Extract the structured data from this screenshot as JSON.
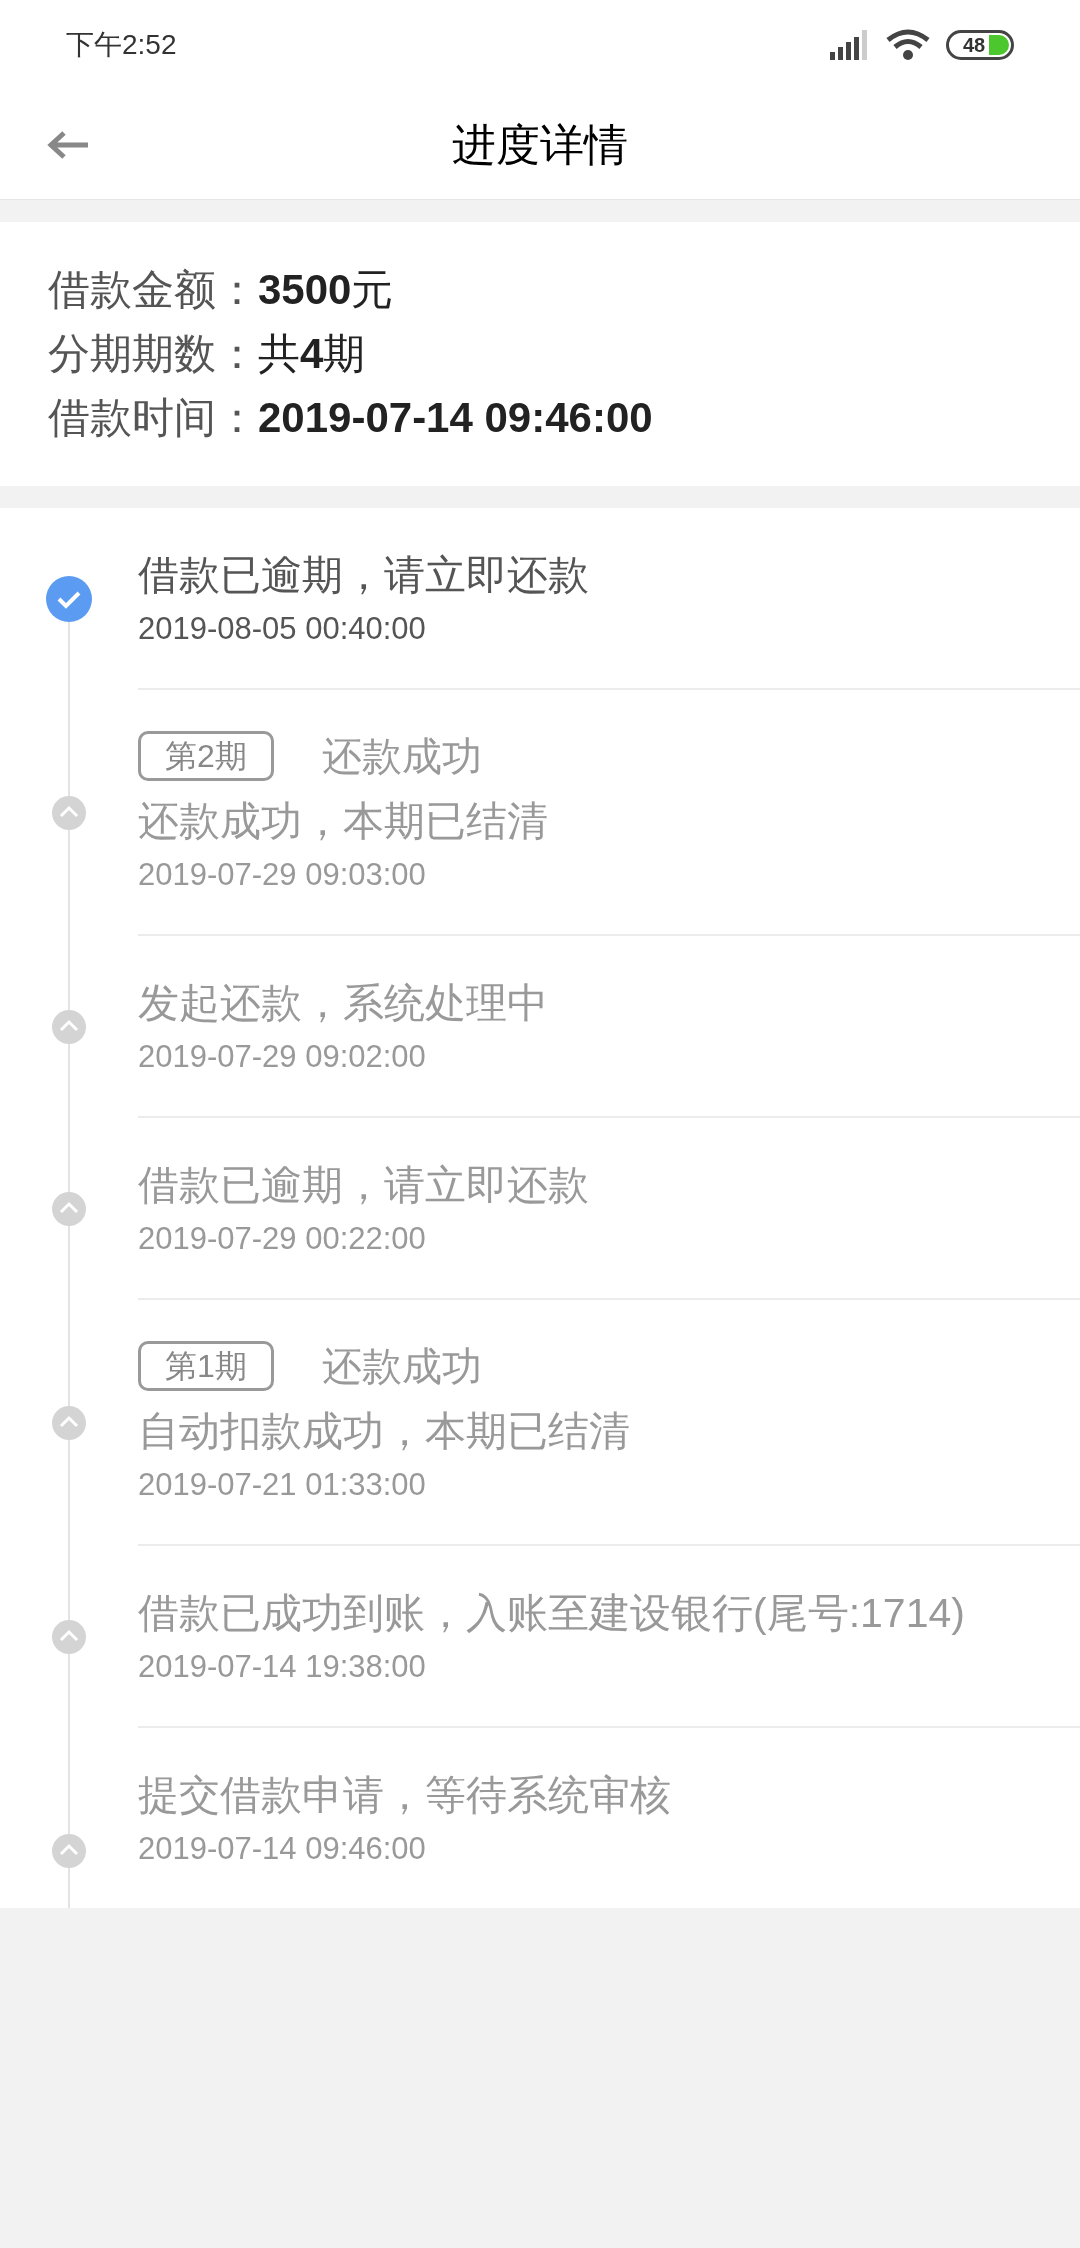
{
  "status_bar": {
    "time": "下午2:52",
    "battery": "48"
  },
  "header": {
    "title": "进度详情"
  },
  "loan_info": [
    {
      "label": "借款金额：",
      "value": "**3500**元"
    },
    {
      "label": "分期期数：",
      "value": "共**4**期"
    },
    {
      "label": "借款时间：",
      "value": "**2019-07-14 09:46:00**"
    }
  ],
  "timeline": [
    {
      "current": true,
      "text": "借款已逾期，请立即还款",
      "time": "2019-08-05 00:40:00"
    },
    {
      "current": false,
      "tag": "第2期",
      "status": "还款成功",
      "text": "还款成功，本期已结清",
      "time": "2019-07-29 09:03:00"
    },
    {
      "current": false,
      "text": "发起还款，系统处理中",
      "time": "2019-07-29 09:02:00"
    },
    {
      "current": false,
      "text": "借款已逾期，请立即还款",
      "time": "2019-07-29 00:22:00"
    },
    {
      "current": false,
      "tag": "第1期",
      "status": "还款成功",
      "text": "自动扣款成功，本期已结清",
      "time": "2019-07-21 01:33:00"
    },
    {
      "current": false,
      "text": "借款已成功到账，入账至建设银行(尾号:1714)",
      "time": "2019-07-14 19:38:00"
    },
    {
      "current": false,
      "text": "提交借款申请，等待系统审核",
      "time": "2019-07-14 09:46:00"
    }
  ]
}
